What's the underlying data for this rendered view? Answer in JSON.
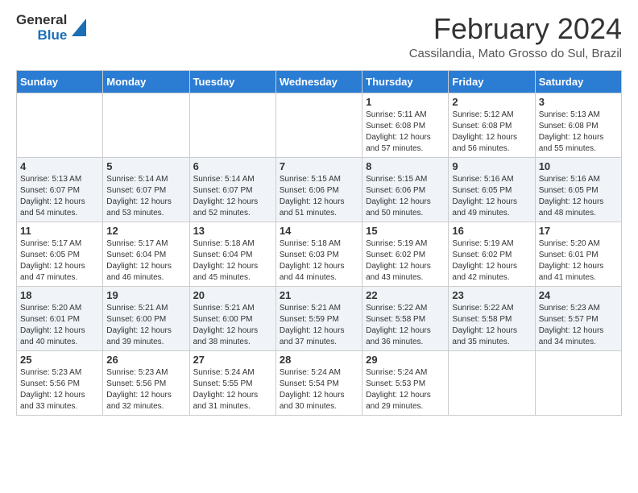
{
  "logo": {
    "text_general": "General",
    "text_blue": "Blue"
  },
  "header": {
    "month": "February 2024",
    "location": "Cassilandia, Mato Grosso do Sul, Brazil"
  },
  "weekdays": [
    "Sunday",
    "Monday",
    "Tuesday",
    "Wednesday",
    "Thursday",
    "Friday",
    "Saturday"
  ],
  "weeks": [
    [
      {
        "day": "",
        "sunrise": "",
        "sunset": "",
        "daylight": ""
      },
      {
        "day": "",
        "sunrise": "",
        "sunset": "",
        "daylight": ""
      },
      {
        "day": "",
        "sunrise": "",
        "sunset": "",
        "daylight": ""
      },
      {
        "day": "",
        "sunrise": "",
        "sunset": "",
        "daylight": ""
      },
      {
        "day": "1",
        "sunrise": "Sunrise: 5:11 AM",
        "sunset": "Sunset: 6:08 PM",
        "daylight": "Daylight: 12 hours and 57 minutes."
      },
      {
        "day": "2",
        "sunrise": "Sunrise: 5:12 AM",
        "sunset": "Sunset: 6:08 PM",
        "daylight": "Daylight: 12 hours and 56 minutes."
      },
      {
        "day": "3",
        "sunrise": "Sunrise: 5:13 AM",
        "sunset": "Sunset: 6:08 PM",
        "daylight": "Daylight: 12 hours and 55 minutes."
      }
    ],
    [
      {
        "day": "4",
        "sunrise": "Sunrise: 5:13 AM",
        "sunset": "Sunset: 6:07 PM",
        "daylight": "Daylight: 12 hours and 54 minutes."
      },
      {
        "day": "5",
        "sunrise": "Sunrise: 5:14 AM",
        "sunset": "Sunset: 6:07 PM",
        "daylight": "Daylight: 12 hours and 53 minutes."
      },
      {
        "day": "6",
        "sunrise": "Sunrise: 5:14 AM",
        "sunset": "Sunset: 6:07 PM",
        "daylight": "Daylight: 12 hours and 52 minutes."
      },
      {
        "day": "7",
        "sunrise": "Sunrise: 5:15 AM",
        "sunset": "Sunset: 6:06 PM",
        "daylight": "Daylight: 12 hours and 51 minutes."
      },
      {
        "day": "8",
        "sunrise": "Sunrise: 5:15 AM",
        "sunset": "Sunset: 6:06 PM",
        "daylight": "Daylight: 12 hours and 50 minutes."
      },
      {
        "day": "9",
        "sunrise": "Sunrise: 5:16 AM",
        "sunset": "Sunset: 6:05 PM",
        "daylight": "Daylight: 12 hours and 49 minutes."
      },
      {
        "day": "10",
        "sunrise": "Sunrise: 5:16 AM",
        "sunset": "Sunset: 6:05 PM",
        "daylight": "Daylight: 12 hours and 48 minutes."
      }
    ],
    [
      {
        "day": "11",
        "sunrise": "Sunrise: 5:17 AM",
        "sunset": "Sunset: 6:05 PM",
        "daylight": "Daylight: 12 hours and 47 minutes."
      },
      {
        "day": "12",
        "sunrise": "Sunrise: 5:17 AM",
        "sunset": "Sunset: 6:04 PM",
        "daylight": "Daylight: 12 hours and 46 minutes."
      },
      {
        "day": "13",
        "sunrise": "Sunrise: 5:18 AM",
        "sunset": "Sunset: 6:04 PM",
        "daylight": "Daylight: 12 hours and 45 minutes."
      },
      {
        "day": "14",
        "sunrise": "Sunrise: 5:18 AM",
        "sunset": "Sunset: 6:03 PM",
        "daylight": "Daylight: 12 hours and 44 minutes."
      },
      {
        "day": "15",
        "sunrise": "Sunrise: 5:19 AM",
        "sunset": "Sunset: 6:02 PM",
        "daylight": "Daylight: 12 hours and 43 minutes."
      },
      {
        "day": "16",
        "sunrise": "Sunrise: 5:19 AM",
        "sunset": "Sunset: 6:02 PM",
        "daylight": "Daylight: 12 hours and 42 minutes."
      },
      {
        "day": "17",
        "sunrise": "Sunrise: 5:20 AM",
        "sunset": "Sunset: 6:01 PM",
        "daylight": "Daylight: 12 hours and 41 minutes."
      }
    ],
    [
      {
        "day": "18",
        "sunrise": "Sunrise: 5:20 AM",
        "sunset": "Sunset: 6:01 PM",
        "daylight": "Daylight: 12 hours and 40 minutes."
      },
      {
        "day": "19",
        "sunrise": "Sunrise: 5:21 AM",
        "sunset": "Sunset: 6:00 PM",
        "daylight": "Daylight: 12 hours and 39 minutes."
      },
      {
        "day": "20",
        "sunrise": "Sunrise: 5:21 AM",
        "sunset": "Sunset: 6:00 PM",
        "daylight": "Daylight: 12 hours and 38 minutes."
      },
      {
        "day": "21",
        "sunrise": "Sunrise: 5:21 AM",
        "sunset": "Sunset: 5:59 PM",
        "daylight": "Daylight: 12 hours and 37 minutes."
      },
      {
        "day": "22",
        "sunrise": "Sunrise: 5:22 AM",
        "sunset": "Sunset: 5:58 PM",
        "daylight": "Daylight: 12 hours and 36 minutes."
      },
      {
        "day": "23",
        "sunrise": "Sunrise: 5:22 AM",
        "sunset": "Sunset: 5:58 PM",
        "daylight": "Daylight: 12 hours and 35 minutes."
      },
      {
        "day": "24",
        "sunrise": "Sunrise: 5:23 AM",
        "sunset": "Sunset: 5:57 PM",
        "daylight": "Daylight: 12 hours and 34 minutes."
      }
    ],
    [
      {
        "day": "25",
        "sunrise": "Sunrise: 5:23 AM",
        "sunset": "Sunset: 5:56 PM",
        "daylight": "Daylight: 12 hours and 33 minutes."
      },
      {
        "day": "26",
        "sunrise": "Sunrise: 5:23 AM",
        "sunset": "Sunset: 5:56 PM",
        "daylight": "Daylight: 12 hours and 32 minutes."
      },
      {
        "day": "27",
        "sunrise": "Sunrise: 5:24 AM",
        "sunset": "Sunset: 5:55 PM",
        "daylight": "Daylight: 12 hours and 31 minutes."
      },
      {
        "day": "28",
        "sunrise": "Sunrise: 5:24 AM",
        "sunset": "Sunset: 5:54 PM",
        "daylight": "Daylight: 12 hours and 30 minutes."
      },
      {
        "day": "29",
        "sunrise": "Sunrise: 5:24 AM",
        "sunset": "Sunset: 5:53 PM",
        "daylight": "Daylight: 12 hours and 29 minutes."
      },
      {
        "day": "",
        "sunrise": "",
        "sunset": "",
        "daylight": ""
      },
      {
        "day": "",
        "sunrise": "",
        "sunset": "",
        "daylight": ""
      }
    ]
  ]
}
